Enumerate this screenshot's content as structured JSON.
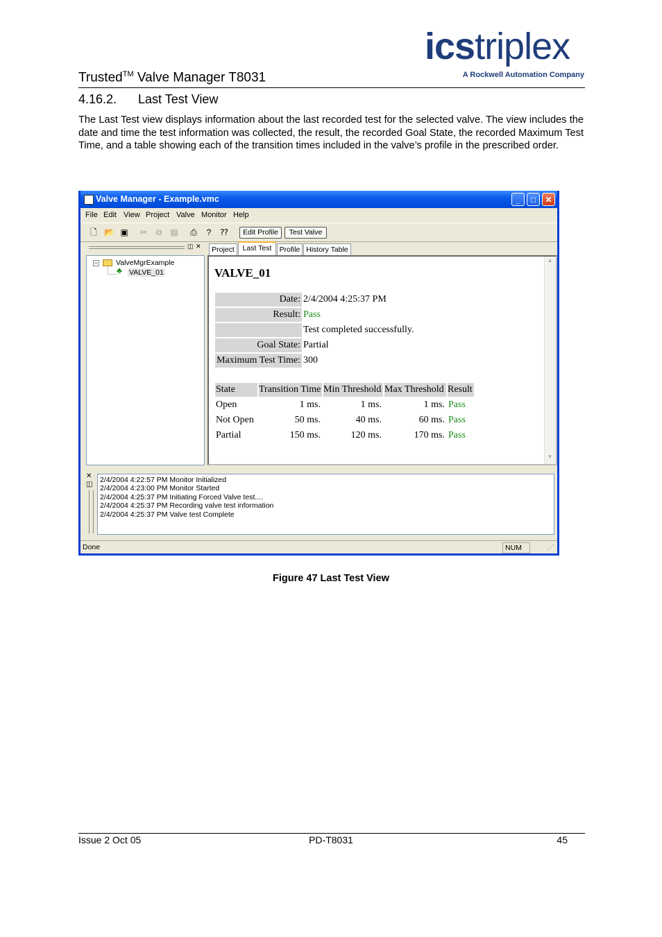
{
  "header": {
    "logo_bold": "ics",
    "logo_light": "triplex",
    "logo_tagline": "A Rockwell Automation Company",
    "doc_title_pre": "Trusted",
    "doc_title_sup": "TM",
    "doc_title_post": " Valve Manager T8031"
  },
  "section": {
    "number": "4.16.2.",
    "title": "Last Test View",
    "paragraph": "The Last Test view displays information about the last recorded test for the selected valve.  The view includes the date and time the test information was collected, the result, the recorded Goal State, the recorded Maximum Test Time, and a table showing each of the transition times included in the valve’s profile in the prescribed order."
  },
  "window": {
    "title": "Valve Manager - Example.vmc",
    "menu": [
      "File",
      "Edit",
      "View",
      "Project",
      "Valve",
      "Monitor",
      "Help"
    ],
    "toolbar_buttons": [
      "Edit Profile",
      "Test Valve"
    ],
    "tabs": [
      "Project",
      "Last Test",
      "Profile",
      "History Table"
    ],
    "active_tab": "Last Test",
    "tree": {
      "root": "ValveMgrExample",
      "child": "VALVE_01"
    },
    "content": {
      "valve_name": "VALVE_01",
      "fields": [
        {
          "label": "Date:",
          "value": "2/4/2004 4:25:37 PM"
        },
        {
          "label": "Result:",
          "value": "Pass"
        },
        {
          "label": "",
          "value": "Test completed successfully."
        },
        {
          "label": "Goal State:",
          "value": "Partial"
        },
        {
          "label": "Maximum Test Time:",
          "value": "300"
        }
      ],
      "table_headers": [
        "State",
        "Transition Time",
        "Min Threshold",
        "Max Threshold",
        "Result"
      ],
      "rows": [
        [
          "Open",
          "1 ms.",
          "1 ms.",
          "1 ms.",
          "Pass"
        ],
        [
          "Not Open",
          "50 ms.",
          "40 ms.",
          "60 ms.",
          "Pass"
        ],
        [
          "Partial",
          "150 ms.",
          "120 ms.",
          "170 ms.",
          "Pass"
        ]
      ]
    },
    "log": [
      "2/4/2004 4:22:57 PM Monitor Initialized",
      "2/4/2004 4:23:00 PM Monitor Started",
      "2/4/2004 4:25:37 PM Initiating Forced Valve test....",
      "2/4/2004 4:25:37 PM Recording valve test information",
      "2/4/2004 4:25:37 PM Valve test Complete"
    ],
    "status_left": "Done",
    "status_right": "NUM"
  },
  "caption": "Figure 47 Last Test View",
  "footer": {
    "left": "Issue 2 Oct 05",
    "center": "PD-T8031",
    "right": "45"
  },
  "colors": {
    "logo": "#1f3d7a",
    "titlebar": "#0b5be8",
    "pass_text": "#1a8a1a",
    "field_label_bg": "#d6d6d6"
  }
}
